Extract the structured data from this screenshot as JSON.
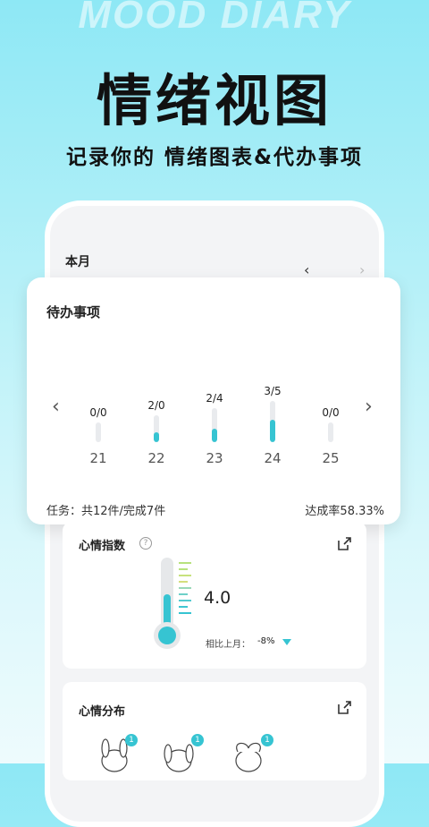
{
  "hero": {
    "bg_text": "MOOD DIARY",
    "title": "情绪视图",
    "subtitle": "记录你的 情绪图表&代办事项"
  },
  "calendar": {
    "month_label": "本月",
    "prev_icon": "chevron-left-icon",
    "next_icon": "chevron-right-icon"
  },
  "todo": {
    "title": "待办事项",
    "days": [
      {
        "fraction": "0/0",
        "day": "21",
        "ratio": 0
      },
      {
        "fraction": "2/0",
        "day": "22",
        "ratio": 0.35
      },
      {
        "fraction": "2/4",
        "day": "23",
        "ratio": 0.4
      },
      {
        "fraction": "3/5",
        "day": "24",
        "ratio": 0.55
      },
      {
        "fraction": "0/0",
        "day": "25",
        "ratio": 0
      }
    ],
    "footer_left": "任务：共12件/完成7件",
    "footer_right": "达成率58.33%"
  },
  "mood_index": {
    "title": "心情指数",
    "value": "4.0",
    "level": 0.55,
    "compare_label": "相比上月：",
    "compare_value": "-8%"
  },
  "mood_distribution": {
    "title": "心情分布",
    "items": [
      {
        "count": "1"
      },
      {
        "count": "1"
      },
      {
        "count": "1"
      }
    ]
  },
  "colors": {
    "accent": "#36c4d2"
  }
}
